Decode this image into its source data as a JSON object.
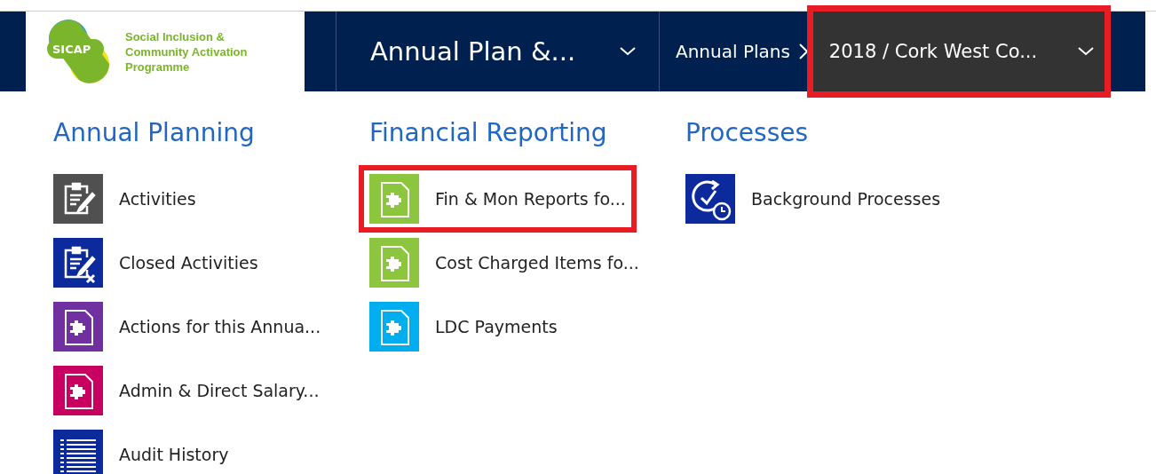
{
  "nav": {
    "logo": {
      "badge": "SICAP",
      "lines": [
        "Social Inclusion &",
        "Community Activation",
        "Programme"
      ]
    },
    "area": {
      "label": "Annual Plan &...",
      "highlighted": false
    },
    "breadcrumb": {
      "label": "Annual Plans"
    },
    "record": {
      "label": "2018 / Cork West Co...",
      "highlighted": true
    }
  },
  "groups": [
    {
      "title": "Annual Planning",
      "items": [
        {
          "label": "Activities",
          "kind": "clipboard",
          "color": "#505050",
          "highlighted": false
        },
        {
          "label": "Closed Activities",
          "kind": "clipboard-closed",
          "color": "#0c2a9c",
          "highlighted": false
        },
        {
          "label": "Actions for this Annua...",
          "kind": "puzzle",
          "color": "#7030a0",
          "highlighted": false
        },
        {
          "label": "Admin & Direct Salary...",
          "kind": "puzzle",
          "color": "#c8005f",
          "highlighted": false
        },
        {
          "label": "Audit History",
          "kind": "list",
          "color": "#0c2a9c",
          "highlighted": false
        }
      ]
    },
    {
      "title": "Financial Reporting",
      "items": [
        {
          "label": "Fin & Mon Reports fo...",
          "kind": "puzzle",
          "color": "#8cc63f",
          "highlighted": true
        },
        {
          "label": "Cost Charged Items fo...",
          "kind": "puzzle",
          "color": "#8cc63f",
          "highlighted": false
        },
        {
          "label": "LDC Payments",
          "kind": "puzzle",
          "color": "#00aeef",
          "highlighted": false
        }
      ]
    },
    {
      "title": "Processes",
      "items": [
        {
          "label": "Background Processes",
          "kind": "process",
          "color": "#0c2a9c",
          "highlighted": false
        }
      ]
    }
  ]
}
